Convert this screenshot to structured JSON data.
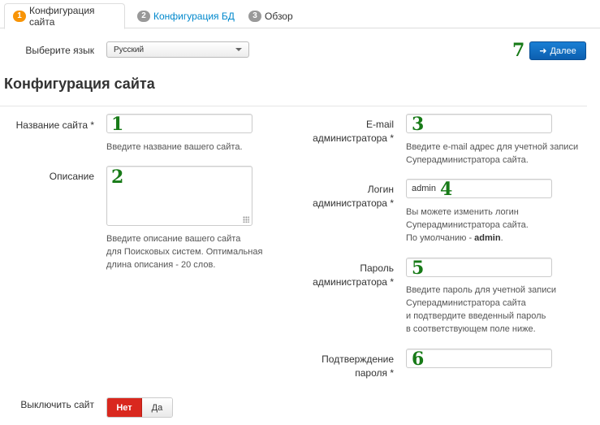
{
  "tabs": [
    {
      "num": "1",
      "label": "Конфигурация сайта"
    },
    {
      "num": "2",
      "label": "Конфигурация БД"
    },
    {
      "num": "3",
      "label": "Обзор"
    }
  ],
  "language": {
    "label": "Выберите язык",
    "selected": "Русский"
  },
  "next_button": {
    "number": "7",
    "label": "Далее"
  },
  "heading": "Конфигурация сайта",
  "fields": {
    "site_name": {
      "label": "Название сайта *",
      "number": "1",
      "value": "",
      "help": "Введите название вашего сайта."
    },
    "description": {
      "label": "Описание",
      "number": "2",
      "value": "",
      "help": [
        "Введите описание вашего сайта",
        "для Поисковых систем. Оптимальная",
        "длина описания - 20 слов."
      ]
    },
    "admin_email": {
      "label": [
        "E-mail",
        "администратора *"
      ],
      "number": "3",
      "value": "",
      "help": [
        "Введите e-mail адрес для учетной записи",
        "Суперадминистратора сайта."
      ]
    },
    "admin_login": {
      "label": [
        "Логин",
        "администратора *"
      ],
      "number": "4",
      "value": "admin",
      "help": [
        "Вы можете изменить логин",
        "Суперадминистратора сайта."
      ],
      "help_default_prefix": "По умолчанию - ",
      "help_default_value": "admin",
      "help_default_suffix": "."
    },
    "admin_password": {
      "label": [
        "Пароль",
        "администратора *"
      ],
      "number": "5",
      "value": "",
      "help": [
        "Введите пароль для учетной записи",
        "Суперадминистратора сайта",
        "и подтвердите введенный пароль",
        "в соответствующем поле ниже."
      ]
    },
    "confirm_password": {
      "label": [
        "Подтверждение",
        "пароля *"
      ],
      "number": "6",
      "value": ""
    }
  },
  "site_offline": {
    "label": "Выключить сайт",
    "no": "Нет",
    "yes": "Да"
  },
  "colors": {
    "accent": "#0c5fb0",
    "badge_active": "#f89406",
    "number_green": "#177a17",
    "toggle_on": "#d9281e",
    "link": "#0088cc"
  }
}
